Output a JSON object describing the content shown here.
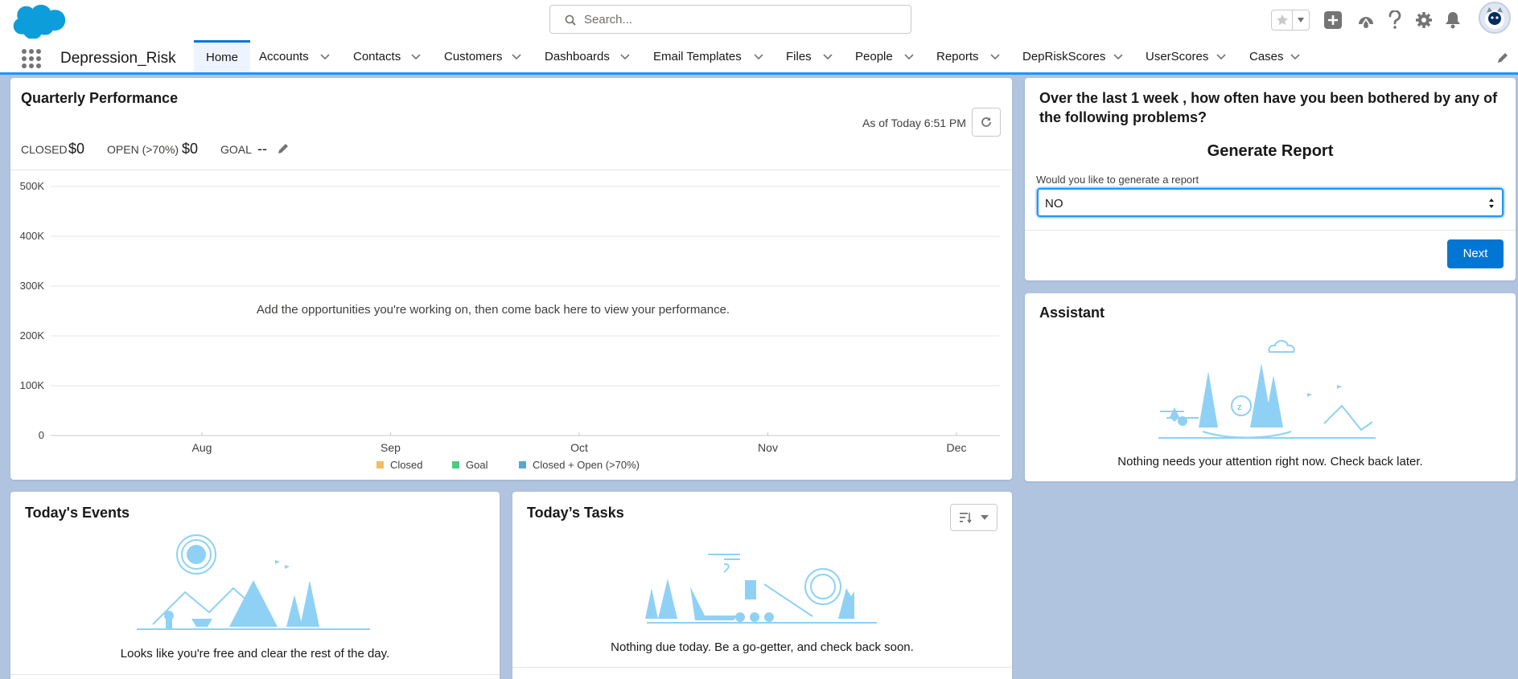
{
  "header": {
    "search_placeholder": "Search..."
  },
  "nav": {
    "app_name": "Depression_Risk",
    "items": [
      {
        "label": "Home",
        "active": true
      },
      {
        "label": "Accounts"
      },
      {
        "label": "Contacts"
      },
      {
        "label": "Customers"
      },
      {
        "label": "Dashboards"
      },
      {
        "label": "Email Templates"
      },
      {
        "label": "Files"
      },
      {
        "label": "People"
      },
      {
        "label": "Reports"
      },
      {
        "label": "DepRiskScores"
      },
      {
        "label": "UserScores"
      },
      {
        "label": "Cases"
      }
    ]
  },
  "quarterly": {
    "title": "Quarterly Performance",
    "as_of": "As of Today 6:51 PM",
    "closed_label": "CLOSED",
    "closed_value": "$0",
    "open_label": "OPEN (>70%)",
    "open_value": "$0",
    "goal_label": "GOAL",
    "goal_value": "--",
    "empty_message": "Add the opportunities you're working on, then come back here to view your performance."
  },
  "chart_data": {
    "type": "line",
    "title": "",
    "x": [
      "Aug",
      "Sep",
      "Oct",
      "Nov",
      "Dec"
    ],
    "y_ticks": [
      "500K",
      "400K",
      "300K",
      "200K",
      "100K",
      "0"
    ],
    "ylim": [
      0,
      500000
    ],
    "grid": true,
    "legend_position": "bottom",
    "series": [
      {
        "name": "Closed",
        "color": "#f4bc5e",
        "values": []
      },
      {
        "name": "Goal",
        "color": "#4bca81",
        "values": []
      },
      {
        "name": "Closed + Open (>70%)",
        "color": "#54a8d6",
        "values": []
      }
    ]
  },
  "survey": {
    "question": "Over the last 1 week , how often have you been bothered by any of the following problems?",
    "subtitle": "Generate Report",
    "field_label": "Would you like to generate a report",
    "selected": "NO",
    "next_label": "Next"
  },
  "assistant": {
    "title": "Assistant",
    "empty_message": "Nothing needs your attention right now. Check back later."
  },
  "events": {
    "title": "Today's Events",
    "empty_message": "Looks like you're free and clear the rest of the day."
  },
  "tasks": {
    "title": "Today’s Tasks",
    "empty_message": "Nothing due today. Be a go-getter, and check back soon."
  },
  "colors": {
    "brand": "#0176d3",
    "nav_active_border": "#1b96ff",
    "background": "#b0c4df",
    "illustration": "#8fd1f5"
  }
}
